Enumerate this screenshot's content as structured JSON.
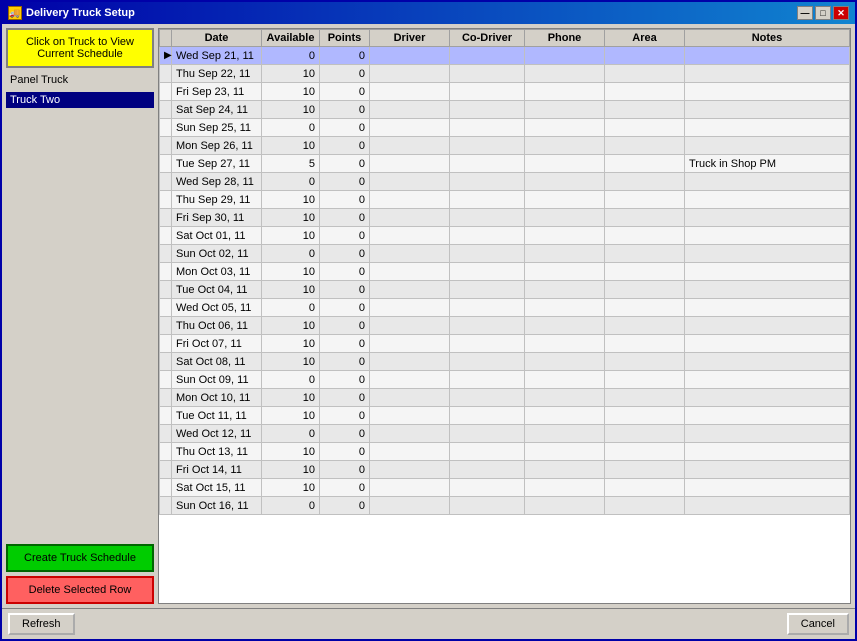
{
  "window": {
    "title": "Delivery Truck Setup",
    "title_icon": "🚚"
  },
  "title_buttons": {
    "minimize": "—",
    "maximize": "□",
    "close": "✕"
  },
  "left_panel": {
    "view_schedule_btn": "Click on Truck to View\nCurrent Schedule",
    "panel_label": "Panel Truck",
    "trucks": [
      {
        "name": "Truck Two",
        "selected": true
      }
    ],
    "create_schedule_btn": "Create Truck Schedule",
    "delete_row_btn": "Delete Selected Row"
  },
  "table": {
    "columns": [
      "Date",
      "Available",
      "Points",
      "Driver",
      "Co-Driver",
      "Phone",
      "Area",
      "Notes"
    ],
    "rows": [
      {
        "date": "Wed Sep 21, 11",
        "available": 0,
        "points": 0,
        "driver": "",
        "codriver": "",
        "phone": "",
        "area": "",
        "notes": "",
        "selected": true,
        "arrow": true
      },
      {
        "date": "Thu Sep 22, 11",
        "available": 10,
        "points": 0,
        "driver": "",
        "codriver": "",
        "phone": "",
        "area": "",
        "notes": ""
      },
      {
        "date": "Fri Sep 23, 11",
        "available": 10,
        "points": 0,
        "driver": "",
        "codriver": "",
        "phone": "",
        "area": "",
        "notes": ""
      },
      {
        "date": "Sat Sep 24, 11",
        "available": 10,
        "points": 0,
        "driver": "",
        "codriver": "",
        "phone": "",
        "area": "",
        "notes": ""
      },
      {
        "date": "Sun Sep 25, 11",
        "available": 0,
        "points": 0,
        "driver": "",
        "codriver": "",
        "phone": "",
        "area": "",
        "notes": ""
      },
      {
        "date": "Mon Sep 26, 11",
        "available": 10,
        "points": 0,
        "driver": "",
        "codriver": "",
        "phone": "",
        "area": "",
        "notes": ""
      },
      {
        "date": "Tue Sep 27, 11",
        "available": 5,
        "points": 0,
        "driver": "",
        "codriver": "",
        "phone": "",
        "area": "",
        "notes": "Truck in Shop PM"
      },
      {
        "date": "Wed Sep 28, 11",
        "available": 0,
        "points": 0,
        "driver": "",
        "codriver": "",
        "phone": "",
        "area": "",
        "notes": ""
      },
      {
        "date": "Thu Sep 29, 11",
        "available": 10,
        "points": 0,
        "driver": "",
        "codriver": "",
        "phone": "",
        "area": "",
        "notes": ""
      },
      {
        "date": "Fri Sep 30, 11",
        "available": 10,
        "points": 0,
        "driver": "",
        "codriver": "",
        "phone": "",
        "area": "",
        "notes": ""
      },
      {
        "date": "Sat Oct 01, 11",
        "available": 10,
        "points": 0,
        "driver": "",
        "codriver": "",
        "phone": "",
        "area": "",
        "notes": ""
      },
      {
        "date": "Sun Oct 02, 11",
        "available": 0,
        "points": 0,
        "driver": "",
        "codriver": "",
        "phone": "",
        "area": "",
        "notes": ""
      },
      {
        "date": "Mon Oct 03, 11",
        "available": 10,
        "points": 0,
        "driver": "",
        "codriver": "",
        "phone": "",
        "area": "",
        "notes": ""
      },
      {
        "date": "Tue Oct 04, 11",
        "available": 10,
        "points": 0,
        "driver": "",
        "codriver": "",
        "phone": "",
        "area": "",
        "notes": ""
      },
      {
        "date": "Wed Oct 05, 11",
        "available": 0,
        "points": 0,
        "driver": "",
        "codriver": "",
        "phone": "",
        "area": "",
        "notes": ""
      },
      {
        "date": "Thu Oct 06, 11",
        "available": 10,
        "points": 0,
        "driver": "",
        "codriver": "",
        "phone": "",
        "area": "",
        "notes": ""
      },
      {
        "date": "Fri Oct 07, 11",
        "available": 10,
        "points": 0,
        "driver": "",
        "codriver": "",
        "phone": "",
        "area": "",
        "notes": ""
      },
      {
        "date": "Sat Oct 08, 11",
        "available": 10,
        "points": 0,
        "driver": "",
        "codriver": "",
        "phone": "",
        "area": "",
        "notes": ""
      },
      {
        "date": "Sun Oct 09, 11",
        "available": 0,
        "points": 0,
        "driver": "",
        "codriver": "",
        "phone": "",
        "area": "",
        "notes": ""
      },
      {
        "date": "Mon Oct 10, 11",
        "available": 10,
        "points": 0,
        "driver": "",
        "codriver": "",
        "phone": "",
        "area": "",
        "notes": ""
      },
      {
        "date": "Tue Oct 11, 11",
        "available": 10,
        "points": 0,
        "driver": "",
        "codriver": "",
        "phone": "",
        "area": "",
        "notes": ""
      },
      {
        "date": "Wed Oct 12, 11",
        "available": 0,
        "points": 0,
        "driver": "",
        "codriver": "",
        "phone": "",
        "area": "",
        "notes": ""
      },
      {
        "date": "Thu Oct 13, 11",
        "available": 10,
        "points": 0,
        "driver": "",
        "codriver": "",
        "phone": "",
        "area": "",
        "notes": ""
      },
      {
        "date": "Fri Oct 14, 11",
        "available": 10,
        "points": 0,
        "driver": "",
        "codriver": "",
        "phone": "",
        "area": "",
        "notes": ""
      },
      {
        "date": "Sat Oct 15, 11",
        "available": 10,
        "points": 0,
        "driver": "",
        "codriver": "",
        "phone": "",
        "area": "",
        "notes": ""
      },
      {
        "date": "Sun Oct 16, 11",
        "available": 0,
        "points": 0,
        "driver": "",
        "codriver": "",
        "phone": "",
        "area": "",
        "notes": ""
      }
    ]
  },
  "bottom_bar": {
    "refresh_btn": "Refresh",
    "cancel_btn": "Cancel"
  }
}
